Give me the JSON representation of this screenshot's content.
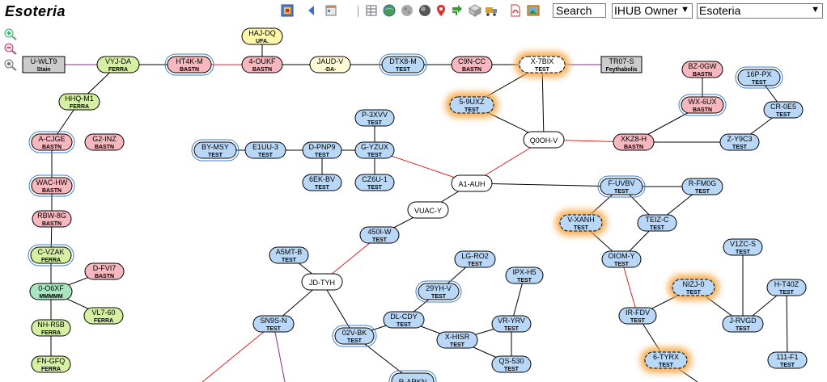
{
  "title": "Esoteria",
  "toolbar": {
    "search_value": "Search",
    "owner_select": "IHUB Owner",
    "system_select": "Esoteria"
  },
  "zoom": {
    "in_icon": "zoom-in-icon",
    "out_icon": "zoom-out-icon",
    "reset_icon": "reset-zoom-icon"
  },
  "colors": {
    "test": "#b9d8f7",
    "bastn": "#f7b7bf",
    "ferra": "#d6f0a3",
    "mmmmm": "#a9e6bf",
    "yellow": "#fff7a8",
    "cream": "#fffbd6",
    "white": "#ffffff",
    "gray": "#cccccc",
    "edge_black": "#000000",
    "edge_red": "#e02020",
    "edge_purple": "#8a2a9a",
    "glow": "#f7a84a"
  },
  "nodes": [
    {
      "id": "U-WLT9",
      "sub": "Stain"
    },
    {
      "id": "VYJ-DA",
      "sub": "FERRA"
    },
    {
      "id": "HT4K-M",
      "sub": "BASTN"
    },
    {
      "id": "HAJ-DQ",
      "sub": "UFA."
    },
    {
      "id": "4-OUKF",
      "sub": "BASTN"
    },
    {
      "id": "JAUD-V",
      "sub": "-DA-"
    },
    {
      "id": "DTX8-M",
      "sub": "TEST"
    },
    {
      "id": "C9N-CC",
      "sub": "BASTN"
    },
    {
      "id": "X-7BIX",
      "sub": "TEST"
    },
    {
      "id": "TR07-S",
      "sub": "Feythabolis"
    },
    {
      "id": "BZ-0GW",
      "sub": "BASTN"
    },
    {
      "id": "16P-PX",
      "sub": "TEST"
    },
    {
      "id": "HHQ-M1",
      "sub": "FERRA"
    },
    {
      "id": "5-9UXZ",
      "sub": "TEST"
    },
    {
      "id": "WX-6UX",
      "sub": "BASTN"
    },
    {
      "id": "CR-0E5",
      "sub": "TEST"
    },
    {
      "id": "P-3XVV",
      "sub": "TEST"
    },
    {
      "id": "A-CJGE",
      "sub": "BASTN"
    },
    {
      "id": "G2-INZ",
      "sub": "BASTN"
    },
    {
      "id": "BY-MSY",
      "sub": "TEST"
    },
    {
      "id": "E1UU-3",
      "sub": "TEST"
    },
    {
      "id": "D-PNP9",
      "sub": "TEST"
    },
    {
      "id": "G-YZUX",
      "sub": "TEST"
    },
    {
      "id": "Q0OH-V",
      "sub": ""
    },
    {
      "id": "XKZ8-H",
      "sub": "BASTN"
    },
    {
      "id": "Z-Y9C3",
      "sub": "TEST"
    },
    {
      "id": "6EK-BV",
      "sub": "TEST"
    },
    {
      "id": "CZ6U-1",
      "sub": "TEST"
    },
    {
      "id": "A1-AUH",
      "sub": ""
    },
    {
      "id": "WAC-HW",
      "sub": "BASTN"
    },
    {
      "id": "F-UVBV",
      "sub": "TEST"
    },
    {
      "id": "R-FM0G",
      "sub": "TEST"
    },
    {
      "id": "VUAC-Y",
      "sub": ""
    },
    {
      "id": "RBW-8G",
      "sub": "BASTN"
    },
    {
      "id": "V-XANH",
      "sub": "TEST"
    },
    {
      "id": "TEIZ-C",
      "sub": "TEST"
    },
    {
      "id": "450I-W",
      "sub": "TEST"
    },
    {
      "id": "A5MT-B",
      "sub": "TEST"
    },
    {
      "id": "LG-RO2",
      "sub": "TEST"
    },
    {
      "id": "C-VZAK",
      "sub": "FERRA"
    },
    {
      "id": "OIOM-Y",
      "sub": "TEST"
    },
    {
      "id": "V1ZC-S",
      "sub": "TEST"
    },
    {
      "id": "D-FVI7",
      "sub": "BASTN"
    },
    {
      "id": "IPX-H5",
      "sub": "TEST"
    },
    {
      "id": "JD-TYH",
      "sub": ""
    },
    {
      "id": "0-O6XF",
      "sub": "MMMMM"
    },
    {
      "id": "29YH-V",
      "sub": "TEST"
    },
    {
      "id": "NIZJ-0",
      "sub": "TEST"
    },
    {
      "id": "H-T40Z",
      "sub": "TEST"
    },
    {
      "id": "VL7-60",
      "sub": "FERRA"
    },
    {
      "id": "IR-FDV",
      "sub": "TEST"
    },
    {
      "id": "DL-CDY",
      "sub": "TEST"
    },
    {
      "id": "SN9S-N",
      "sub": "TEST"
    },
    {
      "id": "VR-YRV",
      "sub": "TEST"
    },
    {
      "id": "J-RVGD",
      "sub": "TEST"
    },
    {
      "id": "NH-R5B",
      "sub": "FERRA"
    },
    {
      "id": "02V-BK",
      "sub": "TEST"
    },
    {
      "id": "X-HISR",
      "sub": "TEST"
    },
    {
      "id": "6-TYRX",
      "sub": "TEST"
    },
    {
      "id": "111-F1",
      "sub": "TEST"
    },
    {
      "id": "QS-530",
      "sub": "TEST"
    },
    {
      "id": "FN-GFQ",
      "sub": "FERRA"
    },
    {
      "id": "R-ARKN",
      "sub": ""
    }
  ]
}
